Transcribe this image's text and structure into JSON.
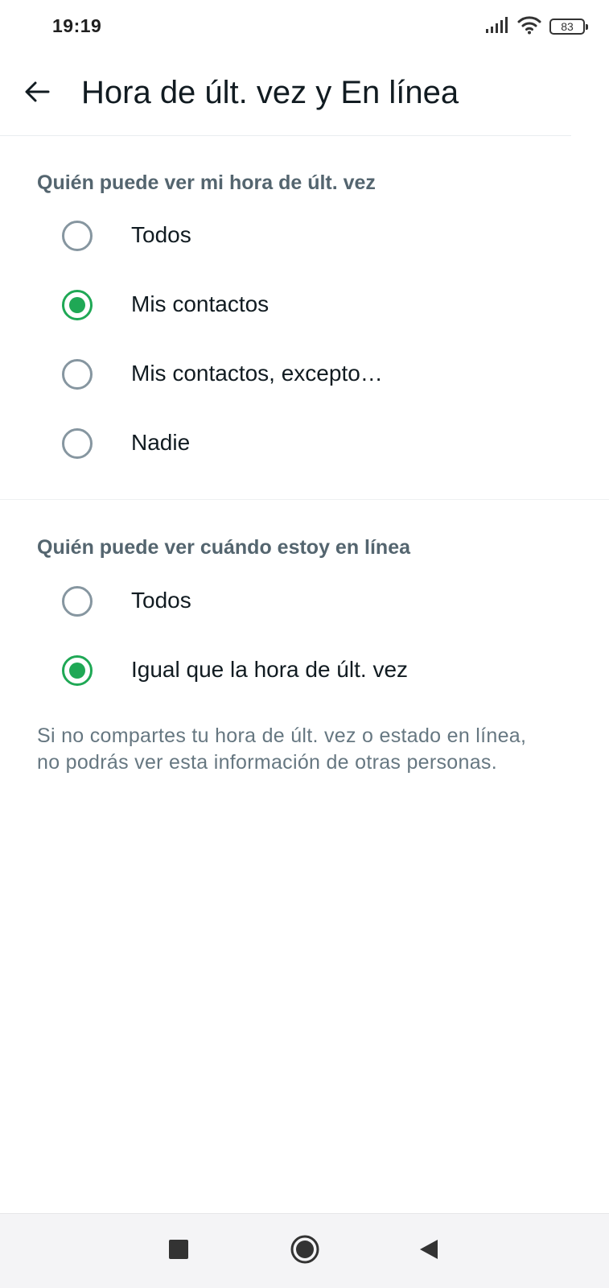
{
  "status_bar": {
    "time": "19:19",
    "battery": "83",
    "icons": [
      "signal-icon",
      "wifi-icon",
      "battery-icon"
    ]
  },
  "app_bar": {
    "title": "Hora de últ. vez y En línea",
    "back_icon": "arrow-left-icon"
  },
  "last_seen": {
    "header": "Quién puede ver mi hora de últ. vez",
    "options": [
      {
        "label": "Todos",
        "selected": false
      },
      {
        "label": "Mis contactos",
        "selected": true
      },
      {
        "label": "Mis contactos, excepto…",
        "selected": false
      },
      {
        "label": "Nadie",
        "selected": false
      }
    ]
  },
  "online": {
    "header": "Quién puede ver cuándo estoy en línea",
    "options": [
      {
        "label": "Todos",
        "selected": false
      },
      {
        "label": "Igual que la hora de últ. vez",
        "selected": true
      }
    ]
  },
  "footnote": "Si no compartes tu hora de últ. vez o estado en línea, no podrás ver esta información de otras personas.",
  "nav_bar": {
    "buttons": [
      "recents-square-icon",
      "home-circle-icon",
      "back-triangle-icon"
    ]
  },
  "colors": {
    "accent": "#1fa855",
    "radio_off": "#8696a0",
    "text_primary": "#111b21",
    "text_secondary": "#54656f"
  }
}
